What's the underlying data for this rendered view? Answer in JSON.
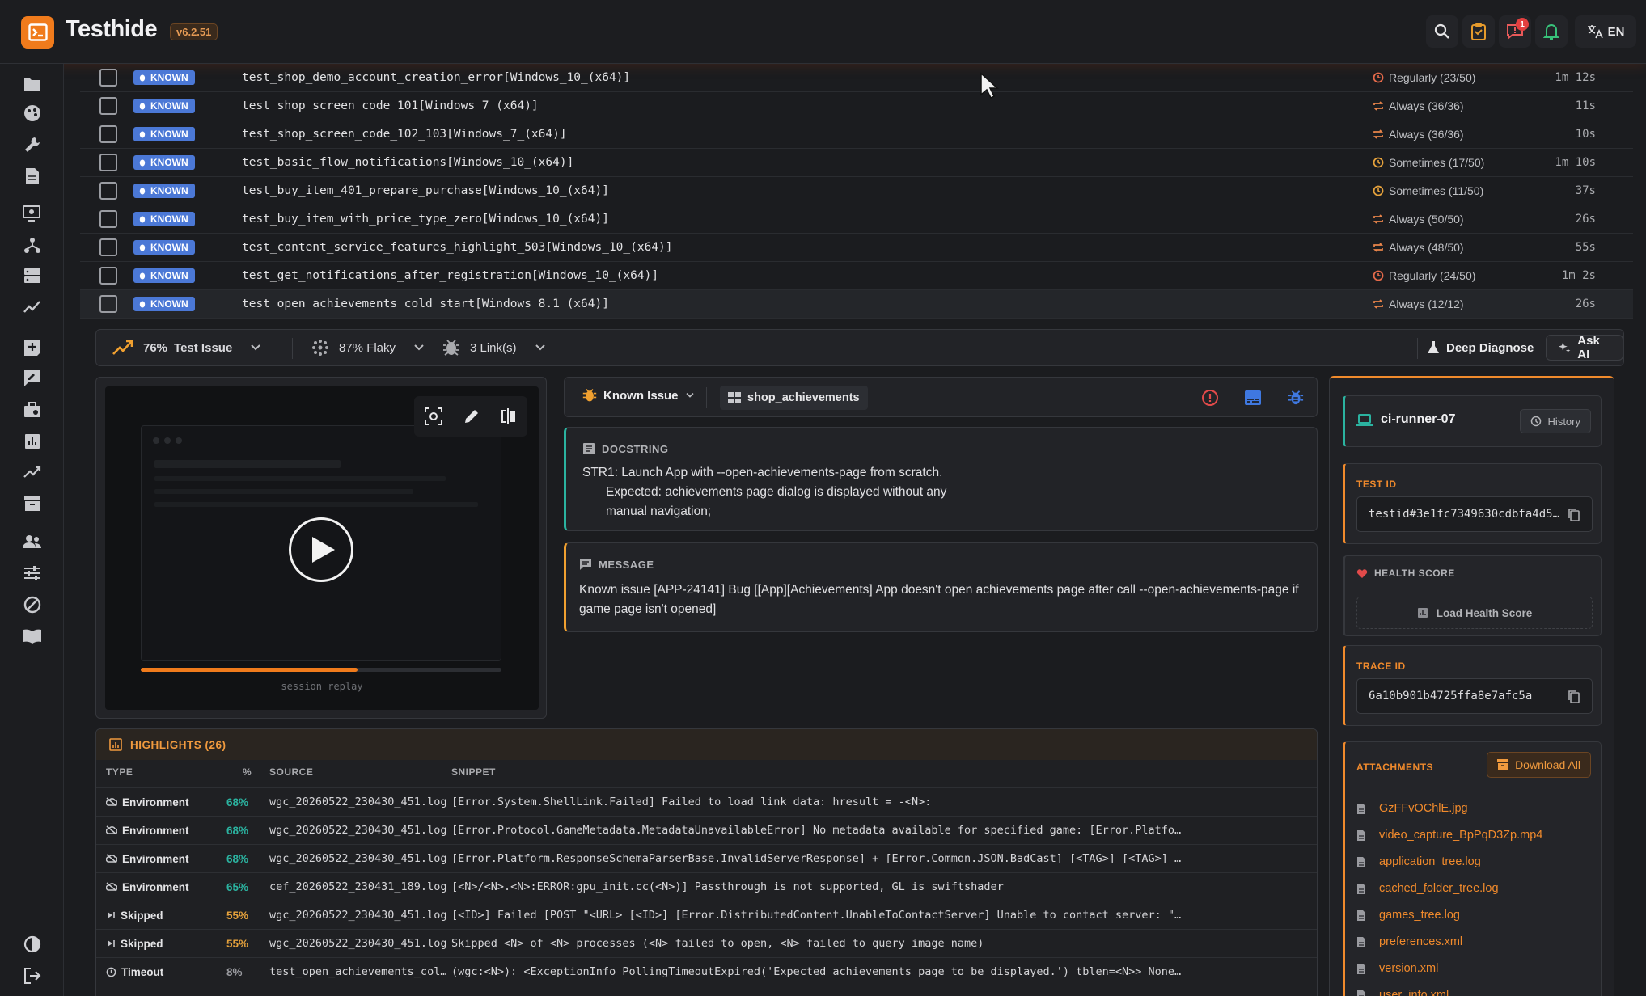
{
  "app": {
    "name": "Testhide",
    "version": "v6.2.51",
    "notification_count": "1",
    "language": "EN"
  },
  "tests": [
    {
      "badge": "KNOWN",
      "name": "test_shop_demo_account_creation_error[Windows_10_(x64)]",
      "frequency": "Regularly (23/50)",
      "freq_kind": "regular",
      "duration": "1m 12s"
    },
    {
      "badge": "KNOWN",
      "name": "test_shop_screen_code_101[Windows_7_(x64)]",
      "frequency": "Always (36/36)",
      "freq_kind": "always",
      "duration": "11s"
    },
    {
      "badge": "KNOWN",
      "name": "test_shop_screen_code_102_103[Windows_7_(x64)]",
      "frequency": "Always (36/36)",
      "freq_kind": "always",
      "duration": "10s"
    },
    {
      "badge": "KNOWN",
      "name": "test_basic_flow_notifications[Windows_10_(x64)]",
      "frequency": "Sometimes (17/50)",
      "freq_kind": "sometimes",
      "duration": "1m 10s"
    },
    {
      "badge": "KNOWN",
      "name": "test_buy_item_401_prepare_purchase[Windows_10_(x64)]",
      "frequency": "Sometimes (11/50)",
      "freq_kind": "sometimes",
      "duration": "37s"
    },
    {
      "badge": "KNOWN",
      "name": "test_buy_item_with_price_type_zero[Windows_10_(x64)]",
      "frequency": "Always (50/50)",
      "freq_kind": "always",
      "duration": "26s"
    },
    {
      "badge": "KNOWN",
      "name": "test_content_service_features_highlight_503[Windows_10_(x64)]",
      "frequency": "Always (48/50)",
      "freq_kind": "always",
      "duration": "55s"
    },
    {
      "badge": "KNOWN",
      "name": "test_get_notifications_after_registration[Windows_10_(x64)]",
      "frequency": "Regularly (24/50)",
      "freq_kind": "regular",
      "duration": "1m 2s"
    },
    {
      "badge": "KNOWN",
      "name": "test_open_achievements_cold_start[Windows_8.1_(x64)]",
      "frequency": "Always (12/12)",
      "freq_kind": "always",
      "duration": "26s"
    }
  ],
  "toolbar": {
    "test_issue_pct": "76%",
    "test_issue_label": "Test Issue",
    "flaky": "87% Flaky",
    "links": "3 Link(s)",
    "deep_diagnose": "Deep Diagnose",
    "ask_ai": "Ask AI"
  },
  "video": {
    "caption": "session replay",
    "progress": 0.6
  },
  "issue": {
    "type": "Known Issue",
    "component": "shop_achievements"
  },
  "docstring": {
    "title": "DOCSTRING",
    "line1": "STR1: Launch App with --open-achievements-page from scratch.",
    "line2": "Expected: achievements page dialog is displayed without any",
    "line3": "manual navigation;"
  },
  "message": {
    "title": "MESSAGE",
    "text": "Known issue [APP-24141] Bug [[App][Achievements] App doesn't open achievements page after call --open-achievements-page if game page isn't opened]"
  },
  "highlights": {
    "title": "HIGHLIGHTS (26)",
    "columns": [
      "TYPE",
      "%",
      "SOURCE",
      "SNIPPET"
    ],
    "rows": [
      {
        "type": "Environment",
        "icon": "cloud-off",
        "pct": "68%",
        "pct_color": "#2bb3a0",
        "source": "wgc_20260522_230430_451.log",
        "snippet": "[Error.System.ShellLink.Failed] Failed to load link data: hresult = -<N>:"
      },
      {
        "type": "Environment",
        "icon": "cloud-off",
        "pct": "68%",
        "pct_color": "#2bb3a0",
        "source": "wgc_20260522_230430_451.log",
        "snippet": "[Error.Protocol.GameMetadata.MetadataUnavailableError] No metadata available for specified game: [Error.Platform.NoMatch…"
      },
      {
        "type": "Environment",
        "icon": "cloud-off",
        "pct": "68%",
        "pct_color": "#2bb3a0",
        "source": "wgc_20260522_230430_451.log",
        "snippet": "[Error.Platform.ResponseSchemaParserBase.InvalidServerResponse] + [Error.Common.JSON.BadCast] [<TAG>] [<TAG>] [Error.Pla…"
      },
      {
        "type": "Environment",
        "icon": "cloud-off",
        "pct": "65%",
        "pct_color": "#2bb3a0",
        "source": "cef_20260522_230431_189.log",
        "snippet": "[<N>/<N>.<N>:ERROR:gpu_init.cc(<N>)] Passthrough is not supported, GL is swiftshader"
      },
      {
        "type": "Skipped",
        "icon": "skip",
        "pct": "55%",
        "pct_color": "#e6a23c",
        "source": "wgc_20260522_230430_451.log",
        "snippet": "[<ID>] Failed [POST \"<URL> [<ID>] [Error.DistributedContent.UnableToContactServer] Unable to contact server: \"<URL> (htt…"
      },
      {
        "type": "Skipped",
        "icon": "skip",
        "pct": "55%",
        "pct_color": "#e6a23c",
        "source": "wgc_20260522_230430_451.log",
        "snippet": "Skipped <N> of <N> processes (<N> failed to open, <N> failed to query image name)"
      },
      {
        "type": "Timeout",
        "icon": "clock",
        "pct": "8%",
        "pct_color": "#9a9ba0",
        "source": "test_open_achievements_col…",
        "snippet": "(wgc:<N>): <ExceptionInfo PollingTimeoutExpired('Expected achievements page to be displayed.') tblen=<N>> NoneType: None"
      }
    ]
  },
  "runner": {
    "name": "ci-runner-07",
    "history": "History"
  },
  "test_id": {
    "label": "TEST ID",
    "value": "testid#3e1fc7349630cdbfa4d5…"
  },
  "health": {
    "label": "HEALTH SCORE",
    "button": "Load Health Score"
  },
  "trace_id": {
    "label": "TRACE ID",
    "value": "6a10b901b4725ffa8e7afc5a"
  },
  "attachments": {
    "label": "ATTACHMENTS",
    "download": "Download All",
    "files": [
      "GzFFvOChlE.jpg",
      "video_capture_BpPqD3Zp.mp4",
      "application_tree.log",
      "cached_folder_tree.log",
      "games_tree.log",
      "preferences.xml",
      "version.xml",
      "user_info.xml"
    ]
  }
}
